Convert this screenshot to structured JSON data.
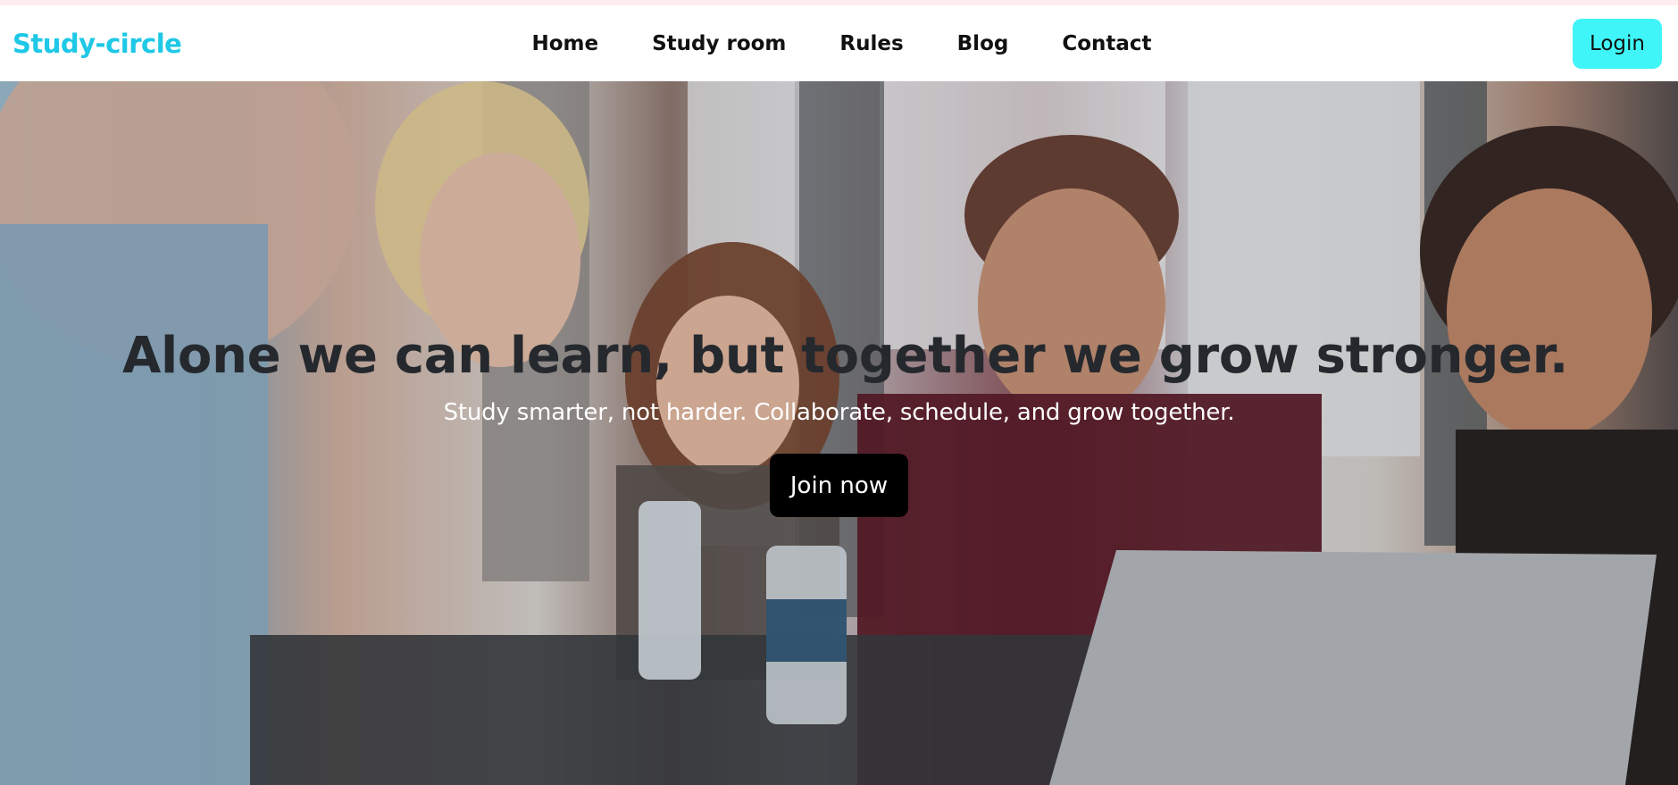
{
  "navbar": {
    "brand": "Study-circle",
    "links": [
      "Home",
      "Study room",
      "Rules",
      "Blog",
      "Contact"
    ],
    "login_label": "Login"
  },
  "hero": {
    "title": "Alone we can learn, but together we grow stronger.",
    "subtitle": "Study smarter, not harder. Collaborate, schedule, and grow together.",
    "cta_label": "Join now"
  },
  "colors": {
    "brand": "#1ec8e6",
    "login_bg": "#3ff5f7",
    "cta_bg": "#000000"
  }
}
